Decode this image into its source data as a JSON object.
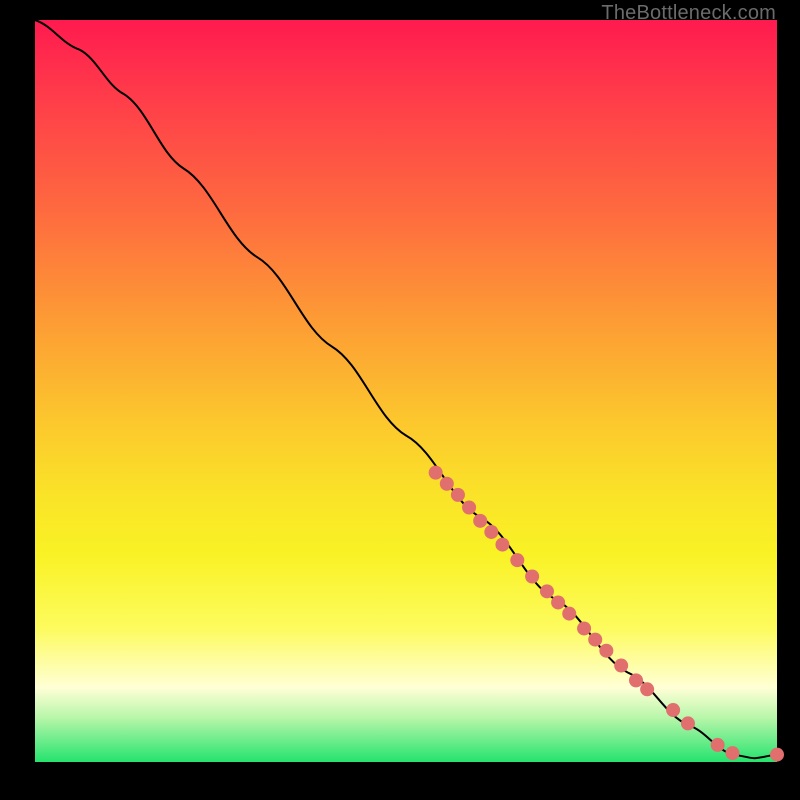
{
  "watermark": "TheBottleneck.com",
  "chart_data": {
    "type": "line",
    "title": "",
    "xlabel": "",
    "ylabel": "",
    "xlim": [
      0,
      100
    ],
    "ylim": [
      0,
      100
    ],
    "curve": [
      {
        "x": 0,
        "y": 100
      },
      {
        "x": 6,
        "y": 96
      },
      {
        "x": 12,
        "y": 90
      },
      {
        "x": 20,
        "y": 80
      },
      {
        "x": 30,
        "y": 68
      },
      {
        "x": 40,
        "y": 56
      },
      {
        "x": 50,
        "y": 44
      },
      {
        "x": 60,
        "y": 33
      },
      {
        "x": 70,
        "y": 22
      },
      {
        "x": 80,
        "y": 12
      },
      {
        "x": 88,
        "y": 5
      },
      {
        "x": 94,
        "y": 1
      },
      {
        "x": 97,
        "y": 0.5
      },
      {
        "x": 100,
        "y": 1
      }
    ],
    "series": [
      {
        "name": "points",
        "color": "#e06f6d",
        "radius": 7,
        "values": [
          {
            "x": 54,
            "y": 39
          },
          {
            "x": 55.5,
            "y": 37.5
          },
          {
            "x": 57,
            "y": 36
          },
          {
            "x": 58.5,
            "y": 34.3
          },
          {
            "x": 60,
            "y": 32.5
          },
          {
            "x": 61.5,
            "y": 31
          },
          {
            "x": 63,
            "y": 29.3
          },
          {
            "x": 65,
            "y": 27.2
          },
          {
            "x": 67,
            "y": 25
          },
          {
            "x": 69,
            "y": 23
          },
          {
            "x": 70.5,
            "y": 21.5
          },
          {
            "x": 72,
            "y": 20
          },
          {
            "x": 74,
            "y": 18
          },
          {
            "x": 75.5,
            "y": 16.5
          },
          {
            "x": 77,
            "y": 15
          },
          {
            "x": 79,
            "y": 13
          },
          {
            "x": 81,
            "y": 11
          },
          {
            "x": 82.5,
            "y": 9.8
          },
          {
            "x": 86,
            "y": 7
          },
          {
            "x": 88,
            "y": 5.2
          },
          {
            "x": 92,
            "y": 2.3
          },
          {
            "x": 94,
            "y": 1.2
          },
          {
            "x": 100,
            "y": 1
          }
        ]
      }
    ]
  }
}
